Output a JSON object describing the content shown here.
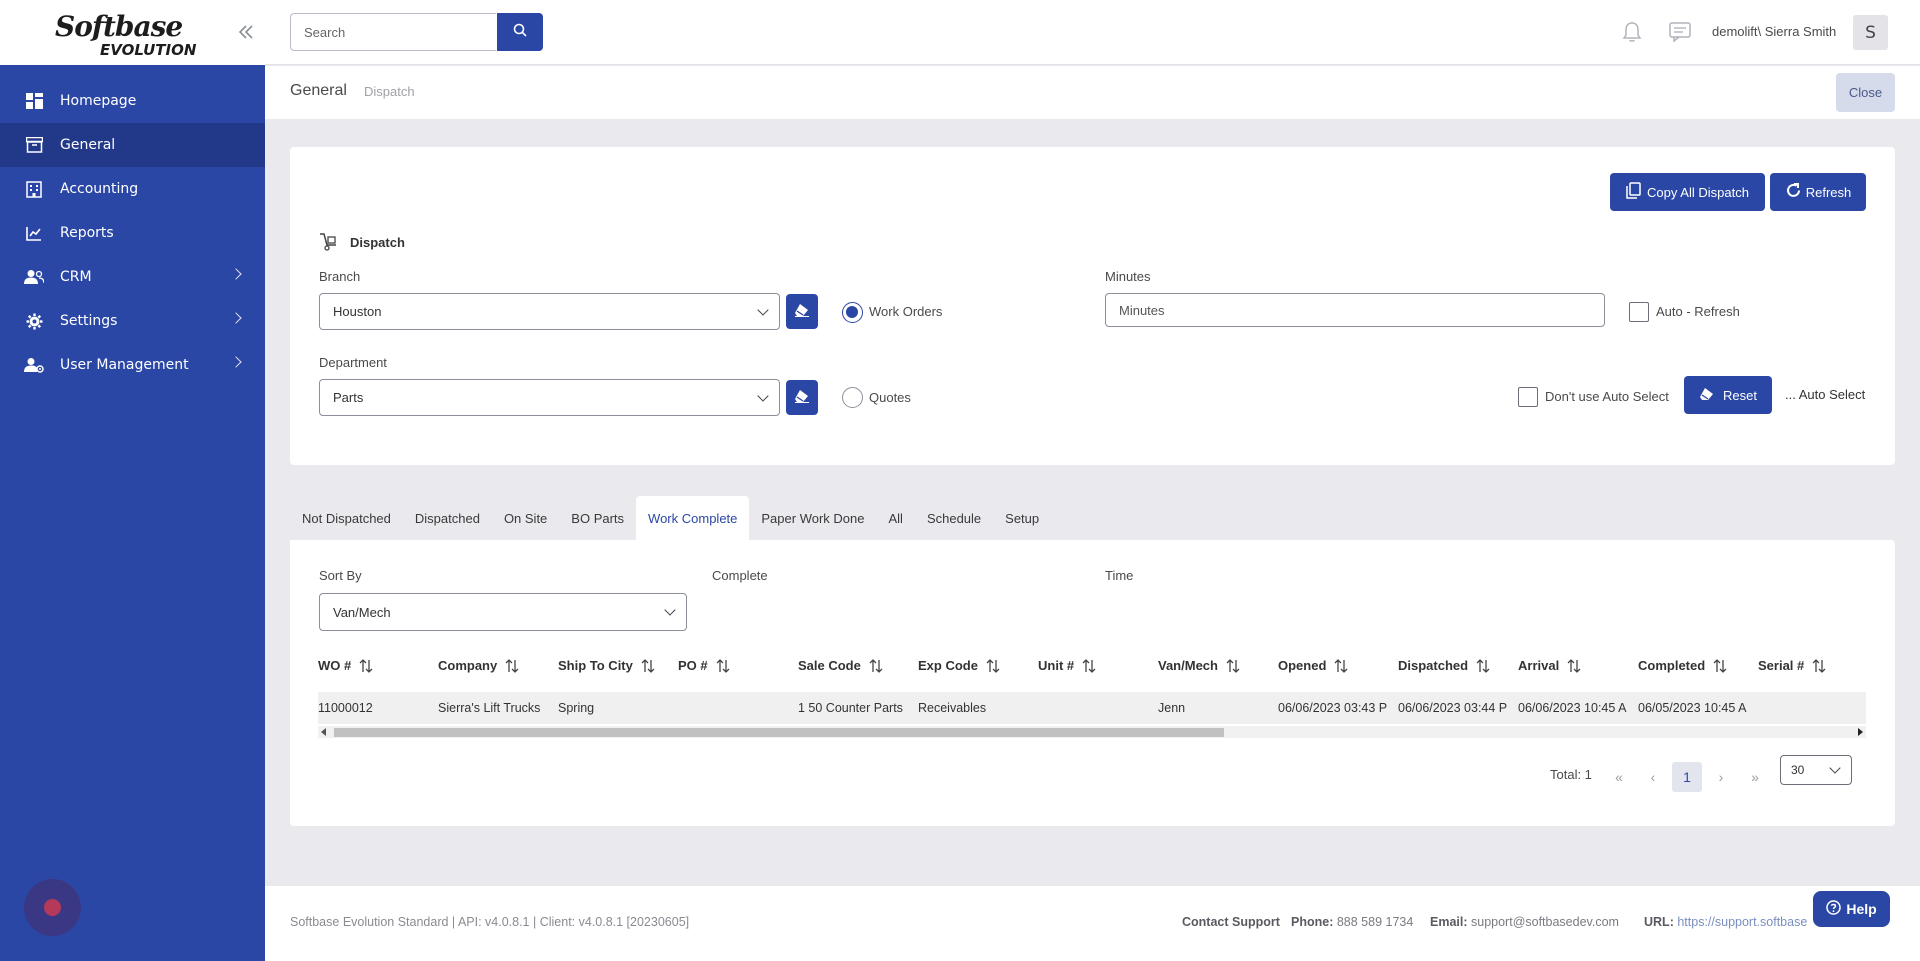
{
  "sidebar": {
    "logo_line1": "Softbase",
    "logo_line2": "EVOLUTION",
    "items": [
      {
        "label": "Homepage",
        "icon": "dashboard-icon"
      },
      {
        "label": "General",
        "icon": "archive-box-icon"
      },
      {
        "label": "Accounting",
        "icon": "building-icon"
      },
      {
        "label": "Reports",
        "icon": "line-chart-icon"
      },
      {
        "label": "CRM",
        "icon": "users-icon"
      },
      {
        "label": "Settings",
        "icon": "gear-icon"
      },
      {
        "label": "User Management",
        "icon": "user-gear-icon"
      }
    ]
  },
  "topbar": {
    "search_placeholder": "Search",
    "username": "demolift\\ Sierra Smith",
    "avatar_initial": "S"
  },
  "breadcrumb": {
    "main": "General",
    "sub": "Dispatch",
    "close_label": "Close"
  },
  "dispatch": {
    "section_title": "Dispatch",
    "copy_all_label": "Copy All Dispatch",
    "refresh_label": "Refresh",
    "branch_label": "Branch",
    "branch_value": "Houston",
    "department_label": "Department",
    "department_value": "Parts",
    "work_orders_label": "Work Orders",
    "quotes_label": "Quotes",
    "minutes_label": "Minutes",
    "minutes_placeholder": "Minutes",
    "auto_refresh_label": "Auto - Refresh",
    "dont_use_auto_select_label": "Don't use Auto Select",
    "reset_label": "Reset",
    "auto_select_label": "... Auto Select"
  },
  "tabs": [
    "Not Dispatched",
    "Dispatched",
    "On Site",
    "BO Parts",
    "Work Complete",
    "Paper Work Done",
    "All",
    "Schedule",
    "Setup"
  ],
  "active_tab": "Work Complete",
  "work_complete": {
    "sort_by_label": "Sort By",
    "sort_by_value": "Van/Mech",
    "complete_label": "Complete",
    "time_label": "Time"
  },
  "grid": {
    "columns": [
      "WO #",
      "Company",
      "Ship To City",
      "PO #",
      "Sale Code",
      "Exp Code",
      "Unit #",
      "Van/Mech",
      "Opened",
      "Dispatched",
      "Arrival",
      "Completed",
      "Serial #"
    ],
    "rows": [
      [
        "11000012",
        "Sierra's Lift Trucks",
        "Spring",
        "",
        "1 50 Counter Parts",
        "Receivables",
        "",
        "Jenn",
        "06/06/2023 03:43 P",
        "06/06/2023 03:44 P",
        "06/06/2023 10:45 A",
        "06/05/2023 10:45 A",
        ""
      ]
    ]
  },
  "pager": {
    "total_label": "Total: 1",
    "current_page": "1",
    "page_size": "30"
  },
  "footer": {
    "version": "Softbase Evolution Standard | API: v4.0.8.1 | Client: v4.0.8.1 [20230605]",
    "contact_label": "Contact Support",
    "phone_label": "Phone:",
    "phone_value": "888 589 1734",
    "email_label": "Email:",
    "email_value": "support@softbasedev.com",
    "url_label": "URL:",
    "url_value": "https://support.softbase"
  },
  "help_label": "Help",
  "colors": {
    "primary": "#2b47a5",
    "sidebar_active": "#22398a",
    "page_bg": "#e9e9ee"
  }
}
